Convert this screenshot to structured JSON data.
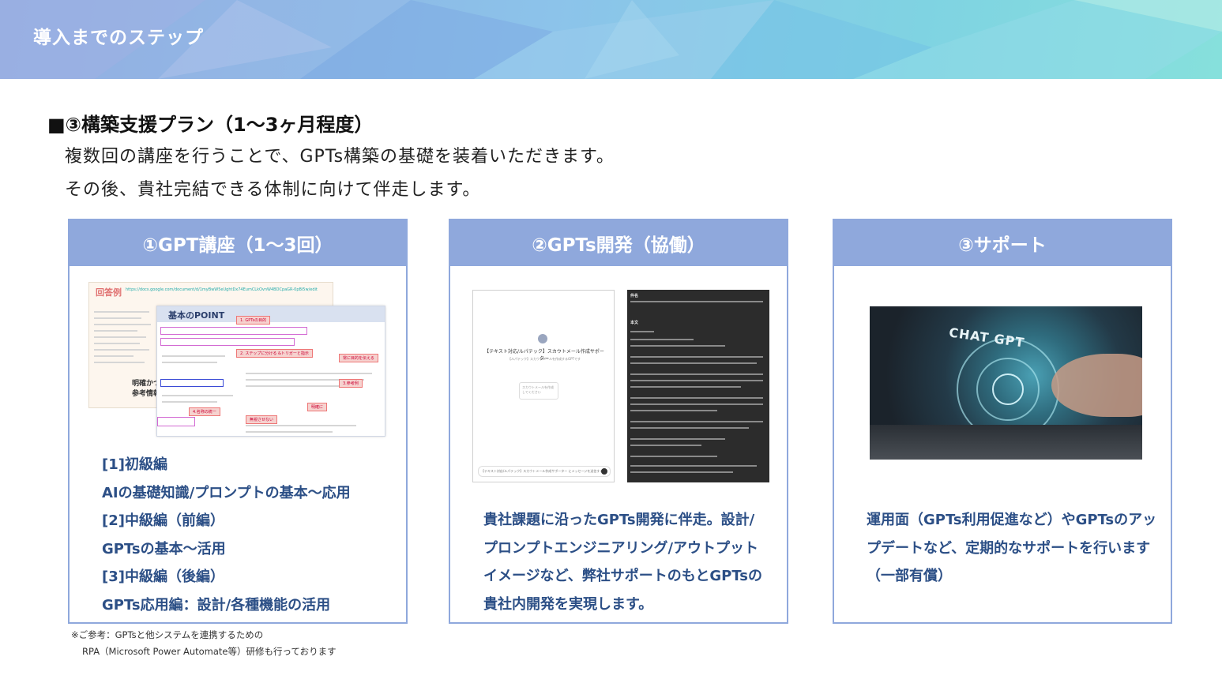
{
  "header": {
    "title": "導入までのステップ",
    "colors": {
      "banner_start": "#8fa8de",
      "banner_end": "#86e0dc"
    }
  },
  "plan": {
    "title": "■③構築支援プラン（1〜3ヶ月程度）",
    "lines": [
      "複数回の講座を行うことで、GPTs構築の基礎を装着いただきます。",
      "その後、貴社完結できる体制に向けて伴走します。"
    ]
  },
  "cards": [
    {
      "title": "①GPT講座（1〜3回）",
      "thumbnail": {
        "tag": "回答例",
        "link": "https://docs.google.com/document/d/1myBwW5eUghtDx74EumCLkOvnW4BDCpaGR-0pBi5w/edit",
        "doc_title": "基本のPOINT",
        "side_text": [
          "明確かつタスク/ステップに分",
          "参考情報とセットで指示"
        ],
        "callouts": [
          "1. GPTsの目的",
          "2. ステップに分ける &トリガーと指示",
          "3.参考例",
          "4.名称の統一",
          "無視させない",
          "常に目的を伝える",
          "明確に"
        ]
      },
      "items": [
        "[1]初級編",
        "AIの基礎知識/プロンプトの基本〜応用",
        "[2]中級編（前編）",
        "GPTsの基本〜活用",
        "[3]中級編（後編）",
        "GPTs応用編：設計/各種機能の活用"
      ]
    },
    {
      "title": "②GPTs開発（協働）",
      "thumbnail": {
        "chat_title": "【テキスト対応/ルパテック】スカウトメール作成サポーター",
        "chat_sub": "【ルパテック】スカウトメールを作成するGPTです",
        "chat_box": "スカウトメールを作成してください",
        "chat_input": "【テキスト対応/ルパテック】スカウトメール作成サポーター にメッセージを送信する",
        "mail_labels": [
          "件名",
          "本文"
        ]
      },
      "paragraph": "貴社課題に沿ったGPTs開発に伴走。設計/プロンプトエンジニアリング/アウトプットイメージなど、弊社サポートのもとGPTsの貴社内開発を実現します。"
    },
    {
      "title": "③サポート",
      "thumbnail": {
        "label": "CHAT GPT"
      },
      "paragraph": "運用面（GPTs利用促進など）やGPTsのアップデートなど、定期的なサポートを行います（一部有償）"
    }
  ],
  "footnote": [
    "※ご参考：GPTsと他システムを連携するための",
    "RPA（Microsoft Power Automate等）研修も行っております"
  ]
}
